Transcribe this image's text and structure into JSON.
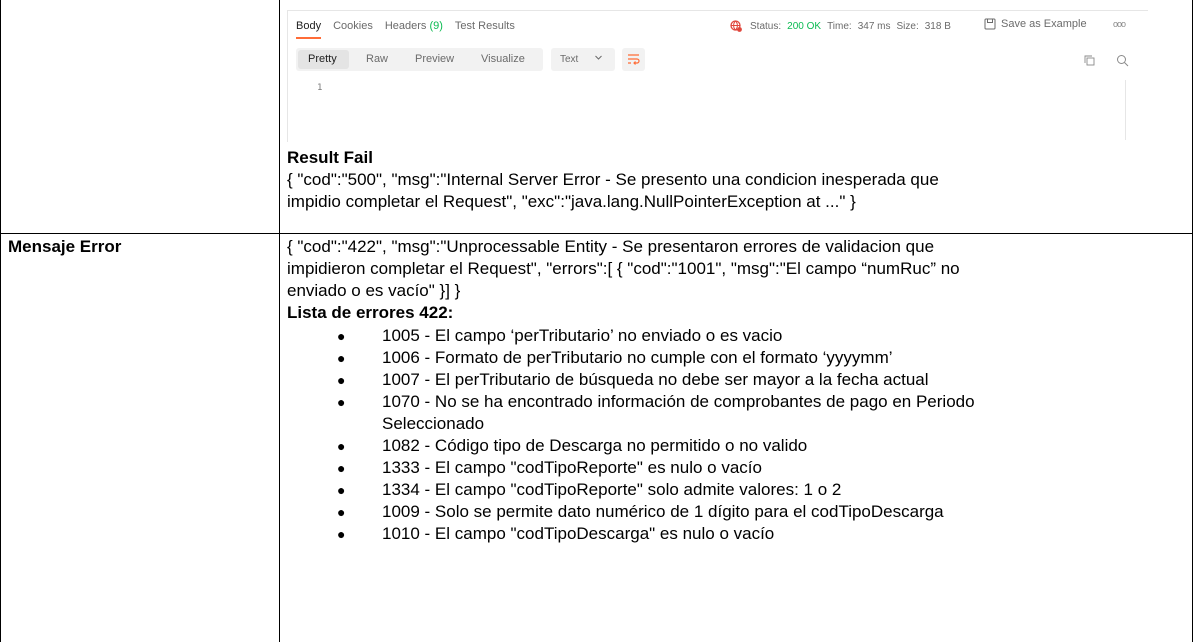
{
  "screenshot": {
    "tabs": [
      {
        "label": "Body"
      },
      {
        "label": "Cookies"
      },
      {
        "label": "Headers",
        "count": "(9)"
      },
      {
        "label": "Test Results"
      }
    ],
    "status_label": "Status:",
    "status_value": "200 OK",
    "time_label": "Time:",
    "time_value": "347 ms",
    "size_label": "Size:",
    "size_value": "318 B",
    "save_label": "Save as Example",
    "more": "ooo",
    "view_modes": [
      "Pretty",
      "Raw",
      "Preview",
      "Visualize"
    ],
    "format_select": "Text",
    "line_number": "1",
    "colors": {
      "accent": "#ff6c37",
      "status_ok": "#0cbb52"
    }
  },
  "result_fail": {
    "title": "Result Fail",
    "line1": "{ \"cod\":\"500\", \"msg\":\"Internal Server Error - Se presento una condicion inesperada que",
    "line2": "impidio completar el Request\", \"exc\":\"java.lang.NullPointerException at ...\" }"
  },
  "mensaje_error": {
    "label": "Mensaje Error",
    "line1": "{ \"cod\":\"422\", \"msg\":\"Unprocessable Entity - Se presentaron errores de validacion que",
    "line2": "impidieron completar el Request\", \"errors\":[ { \"cod\":\"1001\", \"msg\":\"El campo “numRuc” no",
    "line3": "enviado o es vacío\" }] }",
    "list_title": "Lista de errores 422:",
    "errors": [
      "1005 - El campo ‘perTributario’ no enviado o es vacio",
      "1006 - Formato de perTributario no cumple con el formato ‘yyyymm’",
      "1007 - El perTributario de búsqueda no debe ser mayor a la fecha actual",
      "1070 - No se ha encontrado información de comprobantes de pago en Periodo",
      "Seleccionado",
      "1082 - Código tipo de Descarga no permitido o no valido",
      "1333 - El campo \"codTipoReporte\" es nulo o vacío",
      "1334 - El campo \"codTipoReporte\" solo admite valores: 1 o 2",
      "1009 - Solo se permite dato numérico de 1 dígito para el codTipoDescarga",
      "1010 - El campo \"codTipoDescarga\" es nulo o vacío"
    ],
    "bullet": "●"
  }
}
